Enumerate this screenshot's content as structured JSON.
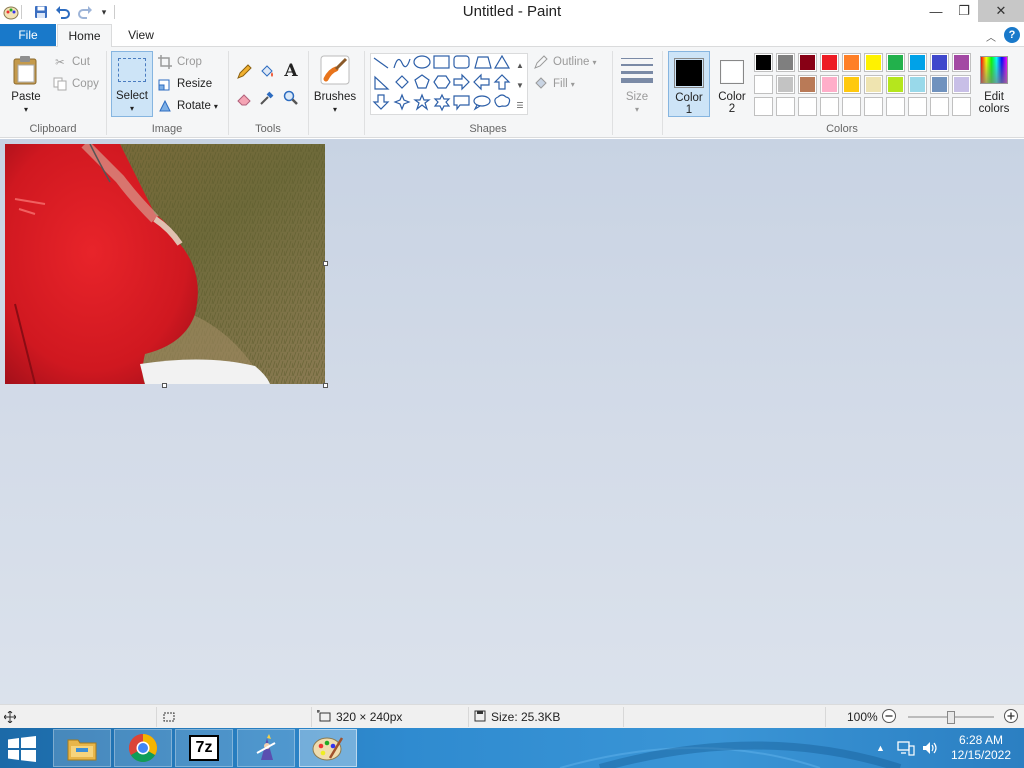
{
  "window": {
    "title": "Untitled - Paint",
    "controls": {
      "minimize": "—",
      "restore": "❐",
      "close": "✕"
    }
  },
  "tabs": {
    "file": "File",
    "home": "Home",
    "view": "View",
    "help": "?"
  },
  "ribbon": {
    "clipboard": {
      "label": "Clipboard",
      "paste": "Paste",
      "cut": "Cut",
      "copy": "Copy"
    },
    "image": {
      "label": "Image",
      "select": "Select",
      "crop": "Crop",
      "resize": "Resize",
      "rotate": "Rotate"
    },
    "tools": {
      "label": "Tools"
    },
    "brushes": {
      "label": "Brushes"
    },
    "shapes": {
      "label": "Shapes",
      "outline": "Outline",
      "fill": "Fill"
    },
    "size": {
      "label": "Size"
    },
    "colors": {
      "label": "Colors",
      "color1_line1": "Color",
      "color1_line2": "1",
      "color2_line1": "Color",
      "color2_line2": "2",
      "edit_line1": "Edit",
      "edit_line2": "colors",
      "color1_value": "#000000",
      "color2_value": "#ffffff",
      "palette_row1": [
        "#000000",
        "#7f7f7f",
        "#880015",
        "#ed1c24",
        "#ff7f27",
        "#fff200",
        "#22b14c",
        "#00a2e8",
        "#3f48cc",
        "#a349a4"
      ],
      "palette_row2": [
        "#ffffff",
        "#c3c3c3",
        "#b97a57",
        "#ffaec9",
        "#ffc90e",
        "#efe4b0",
        "#b5e61d",
        "#99d9ea",
        "#7092be",
        "#c8bfe7"
      ],
      "palette_row3": [
        "",
        "",
        "",
        "",
        "",
        "",
        "",
        "",
        "",
        ""
      ]
    }
  },
  "statusbar": {
    "dimensions": "320 × 240px",
    "size": "Size: 25.3KB",
    "zoom": "100%",
    "zoom_level": 1.0
  },
  "taskbar": {
    "apps": [
      "file-explorer",
      "chrome",
      "7-zip",
      "app",
      "paint"
    ],
    "seven_zip_label": "7z",
    "clock_time": "6:28 AM",
    "clock_date": "12/15/2022"
  }
}
